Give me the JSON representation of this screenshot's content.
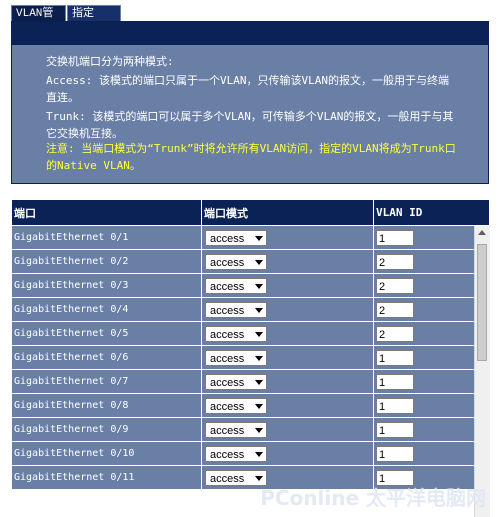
{
  "tabs": [
    {
      "label": "VLAN管理"
    },
    {
      "label": "指定VLAN"
    }
  ],
  "info": {
    "line1": "交换机端口分为两种模式:",
    "line2": "Access: 该模式的端口只属于一个VLAN，只传输该VLAN的报文，一般用于与终端直连。",
    "line3": "Trunk: 该模式的端口可以属于多个VLAN，可传输多个VLAN的报文，一般用于与其它交换机互接。",
    "line4": "注意: 当端口模式为“Trunk”时将允许所有VLAN访问，指定的VLAN将成为Trunk口的Native VLAN。"
  },
  "table": {
    "headers": {
      "port": "端口",
      "mode": "端口模式",
      "vlan": "VLAN ID"
    },
    "rows": [
      {
        "port": "GigabitEthernet 0/1",
        "mode": "access",
        "vlan": "1"
      },
      {
        "port": "GigabitEthernet 0/2",
        "mode": "access",
        "vlan": "2"
      },
      {
        "port": "GigabitEthernet 0/3",
        "mode": "access",
        "vlan": "2"
      },
      {
        "port": "GigabitEthernet 0/4",
        "mode": "access",
        "vlan": "2"
      },
      {
        "port": "GigabitEthernet 0/5",
        "mode": "access",
        "vlan": "2"
      },
      {
        "port": "GigabitEthernet 0/6",
        "mode": "access",
        "vlan": "1"
      },
      {
        "port": "GigabitEthernet 0/7",
        "mode": "access",
        "vlan": "1"
      },
      {
        "port": "GigabitEthernet 0/8",
        "mode": "access",
        "vlan": "1"
      },
      {
        "port": "GigabitEthernet 0/9",
        "mode": "access",
        "vlan": "1"
      },
      {
        "port": "GigabitEthernet 0/10",
        "mode": "access",
        "vlan": "1"
      },
      {
        "port": "GigabitEthernet 0/11",
        "mode": "access",
        "vlan": "1"
      }
    ]
  },
  "watermark": "PConline 太平洋电脑网",
  "colors": {
    "header_bg": "#0b2257",
    "cell_bg": "#6a7fa6",
    "note": "#ffff3a"
  }
}
